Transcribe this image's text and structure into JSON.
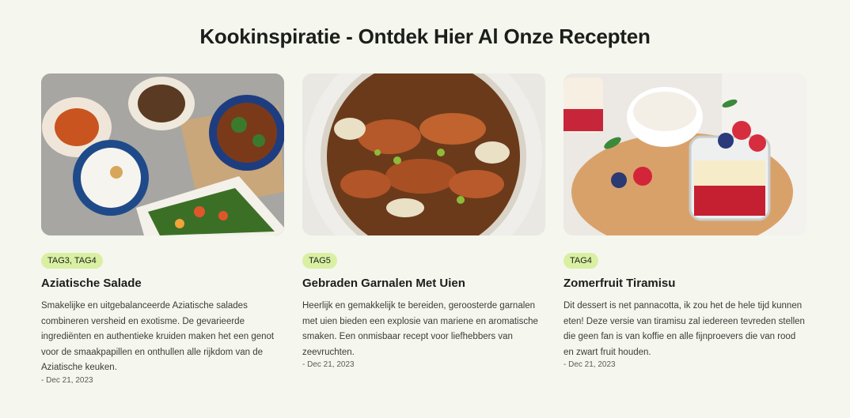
{
  "page": {
    "title": "Kookinspiratie - Ontdek Hier Al Onze Recepten"
  },
  "cards": [
    {
      "image": "asian-salad-photo",
      "tag": "TAG3, TAG4",
      "name": "Aziatische Salade",
      "description": "Smakelijke en uitgebalanceerde Aziatische salades combineren versheid en exotisme. De gevarieerde ingrediënten en authentieke kruiden maken het een genot voor de smaakpapillen en onthullen alle rijkdom van de Aziatische keuken.",
      "date": "- Dec 21, 2023"
    },
    {
      "image": "shrimp-onions-photo",
      "tag": "TAG5",
      "name": "Gebraden Garnalen Met Uien",
      "description": "Heerlijk en gemakkelijk te bereiden, geroosterde garnalen met uien bieden een explosie van mariene en aromatische smaken. Een onmisbaar recept voor liefhebbers van zeevruchten.",
      "date": "- Dec 21, 2023"
    },
    {
      "image": "summer-fruit-tiramisu-photo",
      "tag": "TAG4",
      "name": "Zomerfruit Tiramisu",
      "description": "Dit dessert is net pannacotta, ik zou het de hele tijd kunnen eten! Deze versie van tiramisu zal iedereen tevreden stellen die geen fan is van koffie en alle fijnproevers die van rood en zwart fruit houden.",
      "date": "- Dec 21, 2023"
    }
  ],
  "colors": {
    "background": "#f5f6ee",
    "tag_bg": "#d9f0a3"
  }
}
